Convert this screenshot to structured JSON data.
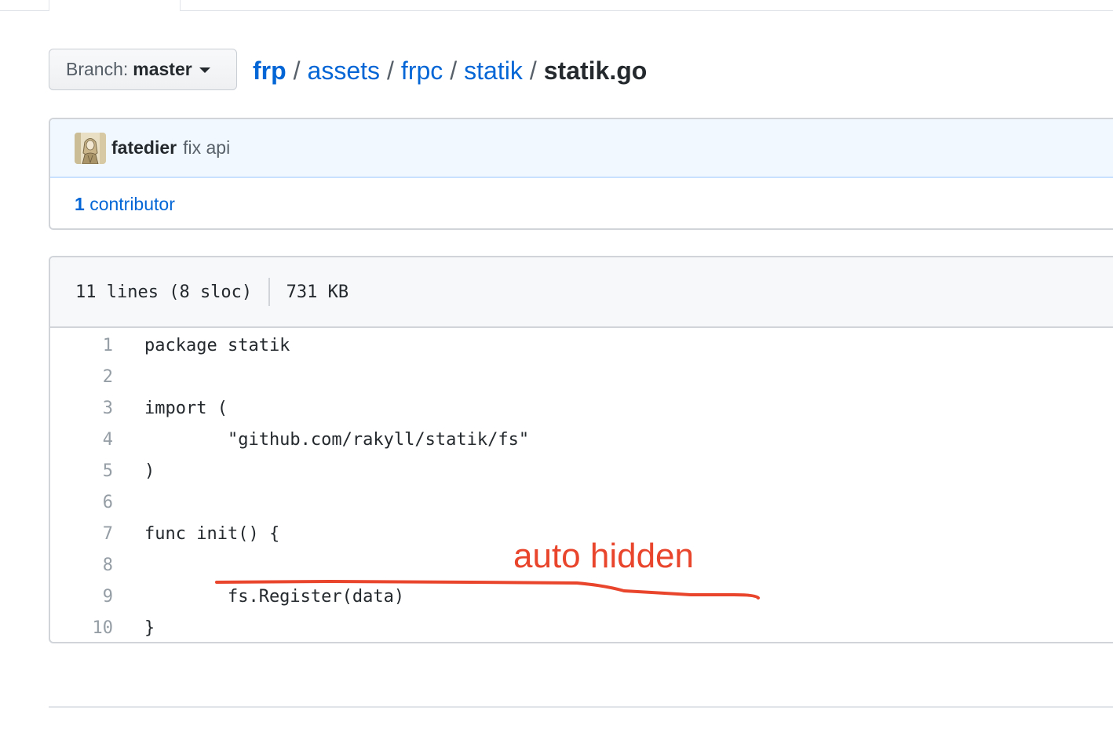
{
  "branch": {
    "label": "Branch:",
    "value": "master"
  },
  "breadcrumb": {
    "repo": "frp",
    "dirs": [
      "assets",
      "frpc",
      "statik"
    ],
    "file": "statik.go",
    "separator": "/"
  },
  "commit": {
    "author": "fatedier",
    "message": "fix api",
    "contributor_count": "1",
    "contributor_label": "contributor"
  },
  "file": {
    "lines_info": "11 lines (8 sloc)",
    "size": "731 KB",
    "code": [
      {
        "n": "1",
        "text": "package statik"
      },
      {
        "n": "2",
        "text": ""
      },
      {
        "n": "3",
        "text": "import ("
      },
      {
        "n": "4",
        "text": "        \"github.com/rakyll/statik/fs\""
      },
      {
        "n": "5",
        "text": ")"
      },
      {
        "n": "6",
        "text": ""
      },
      {
        "n": "7",
        "text": "func init() {"
      },
      {
        "n": "8",
        "text": ""
      },
      {
        "n": "9",
        "text": "        fs.Register(data)"
      },
      {
        "n": "10",
        "text": "}"
      }
    ]
  },
  "annotation": {
    "text": "auto hidden",
    "color": "#e8452c"
  },
  "colors": {
    "link": "#0366d6",
    "text": "#24292e",
    "muted": "#586069",
    "line_number": "#959da5",
    "commit_bg": "#f1f8ff"
  },
  "icons": {
    "branch_caret": "caret-down-icon",
    "avatar": "user-avatar"
  }
}
